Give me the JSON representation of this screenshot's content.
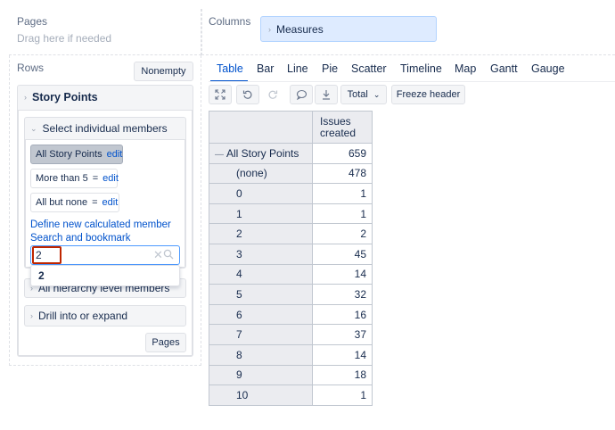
{
  "pages": {
    "title": "Pages",
    "hint": "Drag here if needed"
  },
  "columns": {
    "title": "Columns",
    "chip": "Measures"
  },
  "rows": {
    "title": "Rows",
    "nonempty_button": "Nonempty"
  },
  "dimension": {
    "title": "Story Points"
  },
  "select_members": {
    "title": "Select individual members",
    "chips": [
      {
        "label": "All Story Points",
        "edit": "edit"
      },
      {
        "label": "More than 5",
        "eq": "=",
        "edit": "edit"
      },
      {
        "label": "All but none",
        "eq": "=",
        "edit": "edit"
      }
    ],
    "define_link": "Define new calculated member",
    "search_link": "Search and bookmark"
  },
  "search": {
    "value": "2",
    "suggestion": "2"
  },
  "hierarchy_panel": {
    "title": "All hierarchy level members"
  },
  "drill_panel": {
    "title": "Drill into or expand"
  },
  "pages_button": "Pages",
  "tabs": [
    "Table",
    "Bar",
    "Line",
    "Pie",
    "Scatter",
    "Timeline",
    "Map",
    "Gantt",
    "Gauge"
  ],
  "active_tab": "Table",
  "toolbar": {
    "total_label": "Total",
    "freeze_label": "Freeze header"
  },
  "icons": {
    "expand": "expand-icon",
    "undo": "undo-icon",
    "redo": "redo-icon",
    "comment": "comment-icon",
    "download": "download-icon",
    "clear": "clear-icon",
    "search": "search-icon"
  },
  "table": {
    "column_header_line1": "Issues",
    "column_header_line2": "created",
    "rows": [
      {
        "label": "All Story Points",
        "value": "659",
        "collapse": "—"
      },
      {
        "label": "(none)",
        "value": "478"
      },
      {
        "label": "0",
        "value": "1"
      },
      {
        "label": "1",
        "value": "1"
      },
      {
        "label": "2",
        "value": "2"
      },
      {
        "label": "3",
        "value": "45"
      },
      {
        "label": "4",
        "value": "14"
      },
      {
        "label": "5",
        "value": "32"
      },
      {
        "label": "6",
        "value": "16"
      },
      {
        "label": "7",
        "value": "37"
      },
      {
        "label": "8",
        "value": "14"
      },
      {
        "label": "9",
        "value": "18"
      },
      {
        "label": "10",
        "value": "1"
      }
    ]
  },
  "colors": {
    "accent": "#0052cc",
    "highlight_border": "#bf2600",
    "chip_selected": "#c1c7d0",
    "columns_chip_bg": "#deebff"
  }
}
